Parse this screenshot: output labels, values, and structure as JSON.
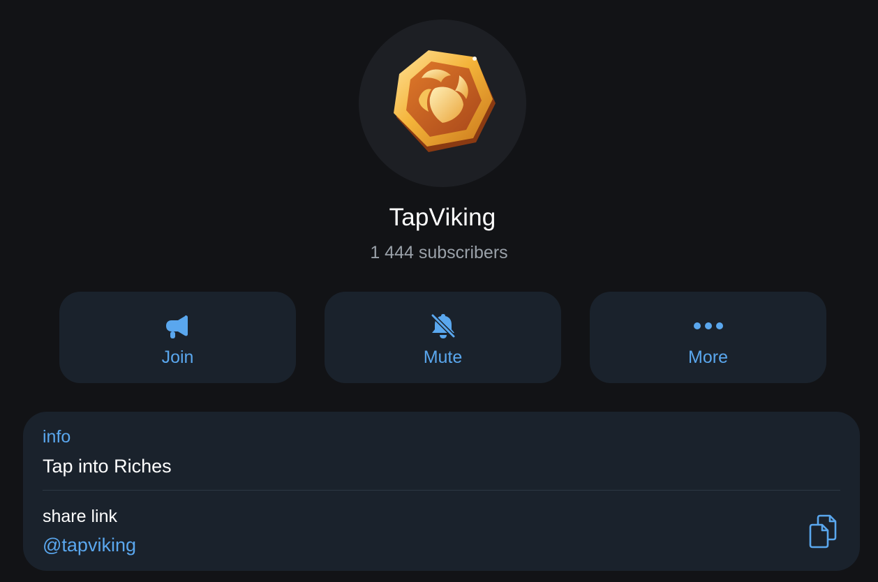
{
  "profile": {
    "name": "TapViking",
    "subscribers": "1 444 subscribers",
    "avatar_icon": "viking-shield-coin-icon"
  },
  "actions": [
    {
      "label": "Join",
      "icon": "megaphone-icon"
    },
    {
      "label": "Mute",
      "icon": "bell-off-icon"
    },
    {
      "label": "More",
      "icon": "more-dots-icon"
    }
  ],
  "info": {
    "label": "info",
    "value": "Tap into Riches"
  },
  "share": {
    "label": "share link",
    "value": "@tapviking",
    "icon": "copy-icon"
  },
  "colors": {
    "background": "#121316",
    "card": "#1a222c",
    "accent": "#5aa7ee",
    "text": "#ffffff",
    "muted": "#9aa1a9"
  }
}
